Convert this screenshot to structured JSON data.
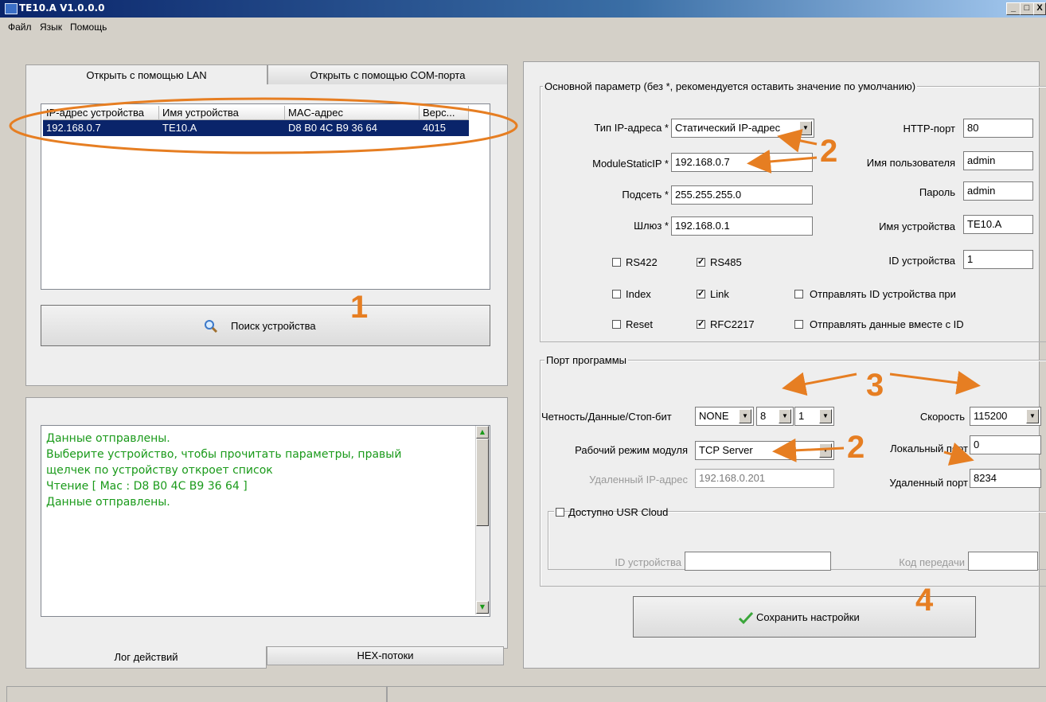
{
  "window": {
    "title": "TE10.A V1.0.0.0",
    "min": "_",
    "max": "□",
    "close": "X"
  },
  "menu": [
    "Файл",
    "Язык",
    "Помощь"
  ],
  "left": {
    "tabs": [
      "Открыть с помощью LAN",
      "Открыть с помощью COM-порта"
    ],
    "columns": [
      "IP-адрес устройства",
      "Имя устройства",
      "MAC-адрес",
      "Верс..."
    ],
    "rows": [
      [
        "192.168.0.7",
        "TE10.A",
        "D8 B0 4C B9 36 64",
        "4015"
      ]
    ],
    "search_label": "Поиск устройства",
    "log_lines": [
      " Данные отправлены.",
      "Выберите устройство, чтобы прочитать параметры, правый",
      "щелчек по устройству откроет список",
      "Чтение [ Mac : D8 B0 4C B9 36 64 ]",
      "  Данные отправлены."
    ],
    "bottom_tabs": [
      "Лог действий",
      "HEX-потоки"
    ]
  },
  "basic": {
    "legend": "Основной параметр (без *, рекомендуется оставить значение по умолчанию)",
    "ip_type_label": "Тип IP-адреса *",
    "ip_type_value": "Статический IP-адрес",
    "static_ip_label": "ModuleStaticIP *",
    "static_ip_value": "192.168.0.7",
    "subnet_label": "Подсеть *",
    "subnet_value": "255.255.255.0",
    "gateway_label": "Шлюз *",
    "gateway_value": "192.168.0.1",
    "http_port_label": "HTTP-порт",
    "http_port_value": "80",
    "username_label": "Имя пользователя",
    "username_value": "admin",
    "password_label": "Пароль",
    "password_value": "admin",
    "device_name_label": "Имя устройства",
    "device_name_value": "TE10.A",
    "device_id_label": "ID устройства",
    "device_id_value": "1",
    "checkboxes": [
      {
        "label": "RS422",
        "checked": false
      },
      {
        "label": "RS485",
        "checked": true
      },
      {
        "label": "Index",
        "checked": false
      },
      {
        "label": "Link",
        "checked": true
      },
      {
        "label": "Reset",
        "checked": false
      },
      {
        "label": "RFC2217",
        "checked": true
      },
      {
        "label": "Отправлять ID устройства при",
        "checked": false
      },
      {
        "label": "Отправлять данные вместе с ID",
        "checked": false
      }
    ]
  },
  "port": {
    "legend": "Порт программы",
    "parity_label": "Четность/Данные/Стоп-бит",
    "parity": "NONE",
    "data_bits": "8",
    "stop_bits": "1",
    "baud_label": "Скорость",
    "baud": "115200",
    "mode_label": "Рабочий режим модуля",
    "mode": "TCP Server",
    "local_port_label": "Локальный порт",
    "local_port": "0",
    "remote_ip_label": "Удаленный IP-адрес",
    "remote_ip": "192.168.0.201",
    "remote_port_label": "Удаленный порт",
    "remote_port": "8234",
    "cloud_label": "Доступно USR Cloud",
    "cloud_id_label": "ID устройства",
    "cloud_code_label": "Код передачи"
  },
  "save_label": "Сохранить настройки",
  "annotations": [
    "1",
    "2",
    "2",
    "3",
    "4"
  ],
  "colors": {
    "annotation": "#e67e22",
    "selection": "#0a246a",
    "log_text": "#1a9a1a"
  }
}
